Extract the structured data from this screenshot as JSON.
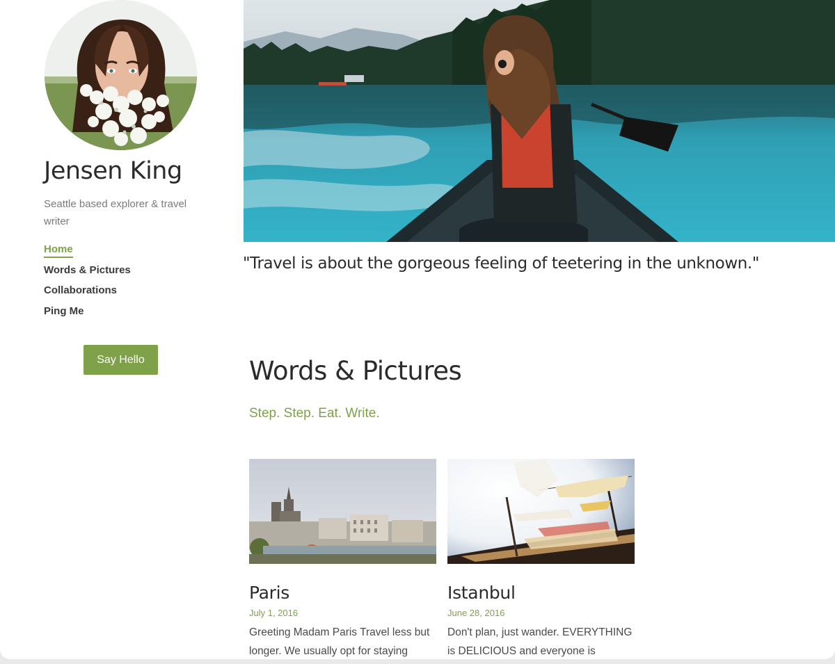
{
  "profile": {
    "name": "Jensen King",
    "tagline": "Seattle based explorer & travel writer"
  },
  "nav": {
    "items": [
      {
        "label": "Home",
        "active": true
      },
      {
        "label": "Words & Pictures",
        "active": false
      },
      {
        "label": "Collaborations",
        "active": false
      },
      {
        "label": "Ping Me",
        "active": false
      }
    ]
  },
  "cta": {
    "say_hello_label": "Say Hello"
  },
  "hero": {
    "quote": "\"Travel is about the gorgeous feeling of teetering in the unknown.\""
  },
  "section": {
    "title": "Words & Pictures",
    "subtitle": "Step. Step. Eat. Write."
  },
  "posts": [
    {
      "title": "Paris",
      "date": "July 1, 2016",
      "excerpt": "Greeting Madam Paris Travel less but longer. We usually opt for staying"
    },
    {
      "title": "Istanbul",
      "date": "June 28, 2016",
      "excerpt": "Don't plan, just wander. EVERYTHING is DELICIOUS and everyone is"
    }
  ],
  "colors": {
    "accent": "#7ea14a",
    "text": "#2b2b2b",
    "muted": "#7a7a7a",
    "background": "#ffffff"
  }
}
